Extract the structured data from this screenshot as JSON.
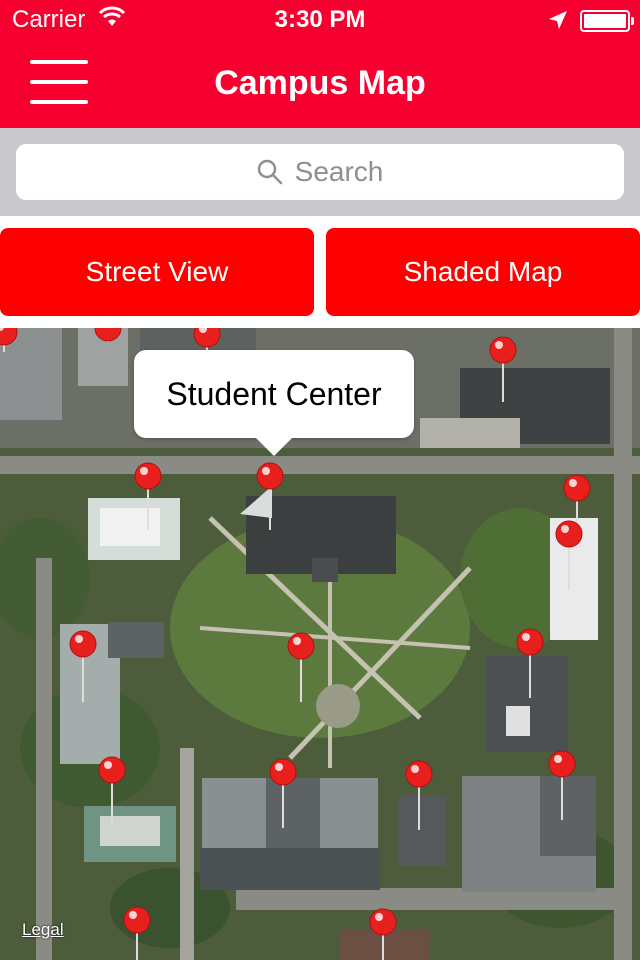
{
  "status_bar": {
    "carrier": "Carrier",
    "time": "3:30 PM",
    "icons": [
      "wifi-icon",
      "location-arrow-icon",
      "battery-icon"
    ]
  },
  "nav": {
    "title": "Campus Map",
    "menu_icon": "hamburger-menu-icon"
  },
  "search": {
    "placeholder": "Search",
    "icon": "search-icon"
  },
  "buttons": {
    "street_view": "Street View",
    "shaded_map": "Shaded Map"
  },
  "map": {
    "callout": "Student Center",
    "legal": "Legal",
    "pin_icon": "map-pin-icon",
    "colors": {
      "pin": "#e8201d",
      "bar": "#f5002f",
      "button": "#ff0000"
    }
  }
}
